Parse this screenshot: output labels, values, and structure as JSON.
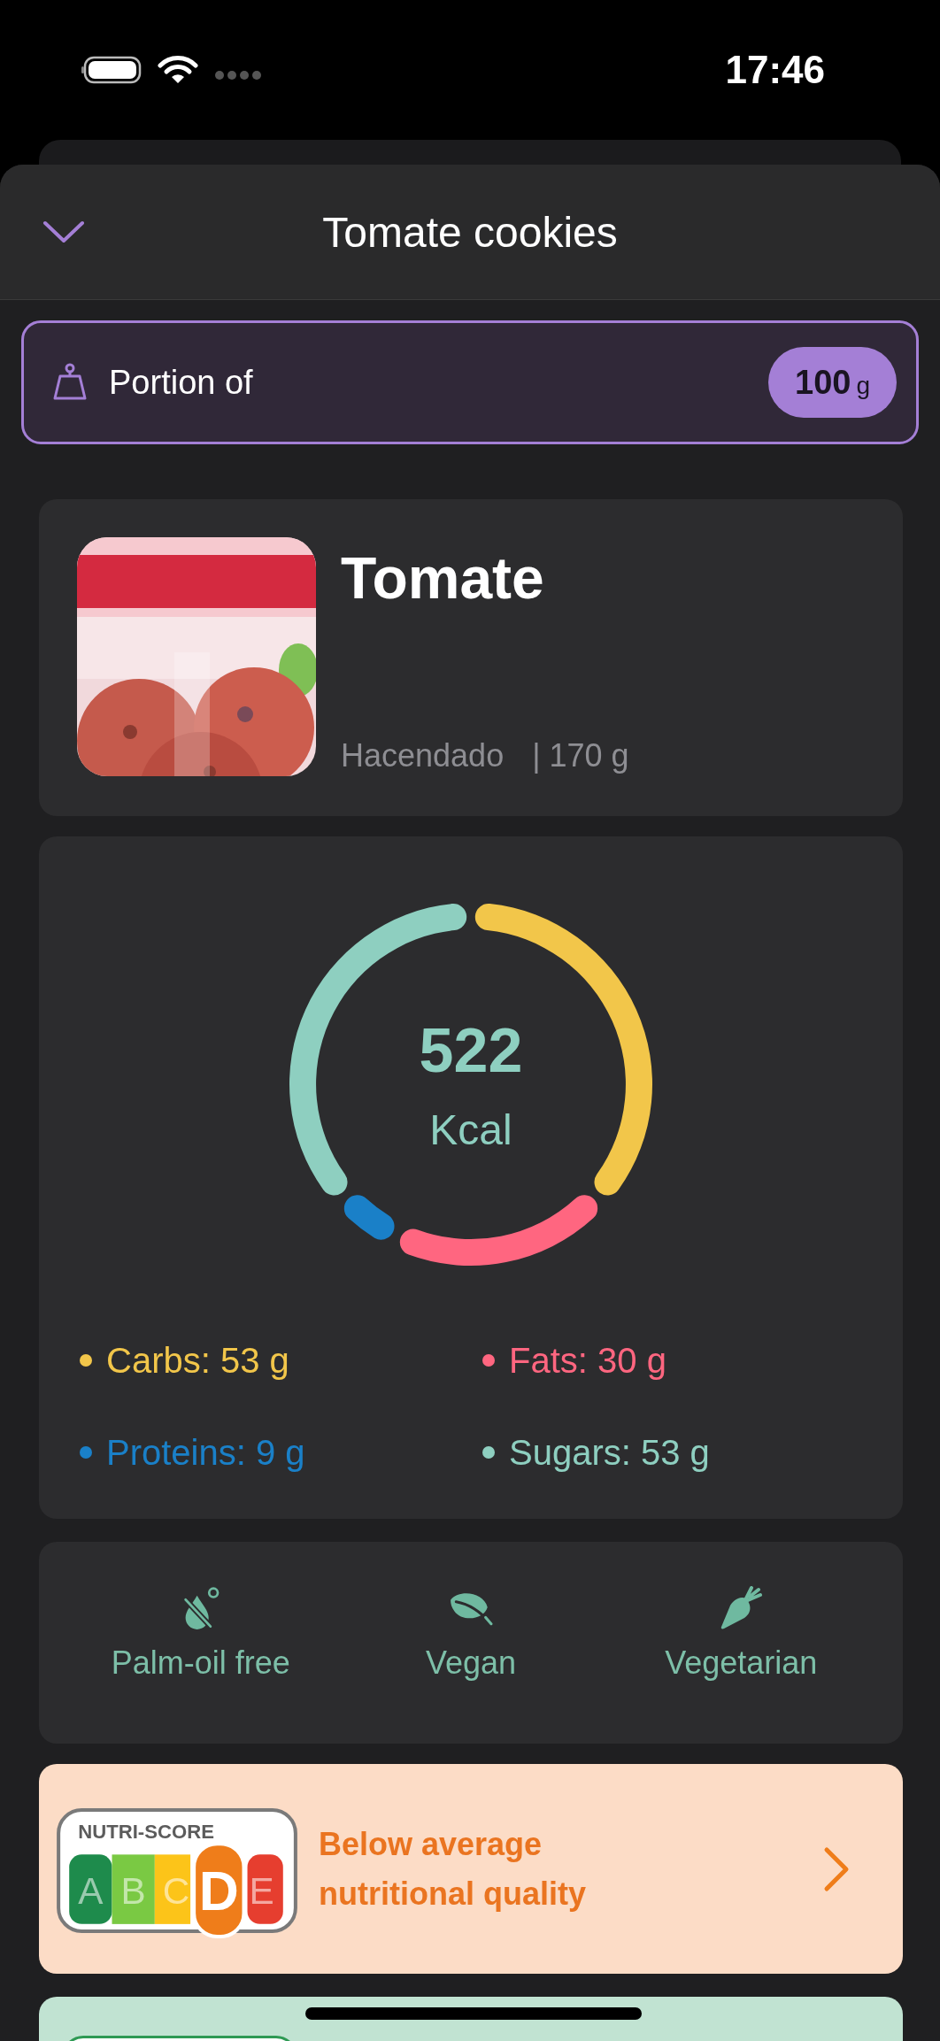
{
  "status_bar": {
    "time": "17:46"
  },
  "header": {
    "title": "Tomate cookies"
  },
  "portion": {
    "label": "Portion of",
    "value": "100",
    "unit": "g"
  },
  "product": {
    "name": "Tomate",
    "brand": "Hacendado",
    "weight": "| 170 g"
  },
  "energy": {
    "value": "522",
    "unit": "Kcal",
    "chart_data": {
      "type": "donut",
      "values": [
        36.55,
        20.69,
        6.21,
        36.55
      ]
    },
    "legend": [
      {
        "label": "Carbs: 53 g",
        "color": "#f2c64a"
      },
      {
        "label": "Fats: 30 g",
        "color": "#ff6680"
      },
      {
        "label": "Proteins: 9 g",
        "color": "#1a80c8"
      },
      {
        "label": "Sugars: 53 g",
        "color": "#8ecfc0"
      }
    ]
  },
  "labels": [
    {
      "kind": "palm-oil-free",
      "text": "Palm-oil free"
    },
    {
      "kind": "vegan",
      "text": "Vegan"
    },
    {
      "kind": "vegetarian",
      "text": "Vegetarian"
    }
  ],
  "nutriscore": {
    "title": "NUTRI-SCORE",
    "grades": [
      {
        "letter": "A",
        "color": "#1e8b4c",
        "selected": false
      },
      {
        "letter": "B",
        "color": "#7ac943",
        "selected": false
      },
      {
        "letter": "C",
        "color": "#fcc419",
        "selected": false
      },
      {
        "letter": "D",
        "color": "#ef7d1a",
        "selected": true
      },
      {
        "letter": "E",
        "color": "#e63e2f",
        "selected": false
      }
    ],
    "text": "Below average nutritional quality"
  }
}
